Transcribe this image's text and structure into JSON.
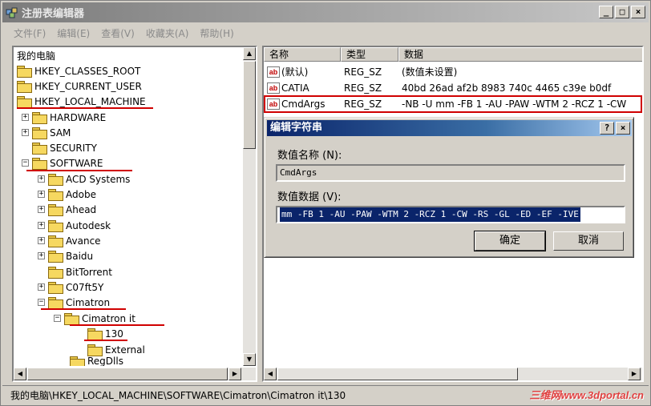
{
  "window": {
    "title": "注册表编辑器"
  },
  "menu": [
    "文件(F)",
    "编辑(E)",
    "查看(V)",
    "收藏夹(A)",
    "帮助(H)"
  ],
  "tree": {
    "root": "我的电脑",
    "nodes": [
      {
        "label": "HKEY_CLASSES_ROOT"
      },
      {
        "label": "HKEY_CURRENT_USER"
      },
      {
        "label": "HKEY_LOCAL_MACHINE"
      },
      {
        "label": "HARDWARE"
      },
      {
        "label": "SAM"
      },
      {
        "label": "SECURITY"
      },
      {
        "label": "SOFTWARE"
      },
      {
        "label": "ACD Systems"
      },
      {
        "label": "Adobe"
      },
      {
        "label": "Ahead"
      },
      {
        "label": "Autodesk"
      },
      {
        "label": "Avance"
      },
      {
        "label": "Baidu"
      },
      {
        "label": "BitTorrent"
      },
      {
        "label": "C07ft5Y"
      },
      {
        "label": "Cimatron"
      },
      {
        "label": "Cimatron it"
      },
      {
        "label": "130"
      },
      {
        "label": "External"
      },
      {
        "label": "RegDlls"
      }
    ]
  },
  "list": {
    "headers": [
      "名称",
      "类型",
      "数据"
    ],
    "rows": [
      {
        "name": "(默认)",
        "type": "REG_SZ",
        "data": "(数值未设置)"
      },
      {
        "name": "CATIA",
        "type": "REG_SZ",
        "data": "40bd 26ad af2b 8983 740c 4465 c39e b0df"
      },
      {
        "name": "CmdArgs",
        "type": "REG_SZ",
        "data": "-NB -U mm -FB 1 -AU -PAW -WTM 2 -RCZ 1 -CW"
      }
    ]
  },
  "dialog": {
    "title": "编辑字符串",
    "name_label": "数值名称 (N):",
    "name_value": "CmdArgs",
    "data_label": "数值数据 (V):",
    "data_value": "mm -FB 1 -AU  -PAW  -WTM 2 -RCZ 1 -CW  -RS -GL -ED -EF -IVE",
    "ok_label": "确定",
    "cancel_label": "取消",
    "help_btn": "?",
    "close_btn": "×"
  },
  "statusbar": {
    "path": "我的电脑\\HKEY_LOCAL_MACHINE\\SOFTWARE\\Cimatron\\Cimatron it\\130"
  },
  "watermark": "三维网www.3dportal.cn",
  "colors": {
    "highlight_red": "#d00000",
    "dialog_title": "#0a246a",
    "selection": "#0a246a"
  }
}
